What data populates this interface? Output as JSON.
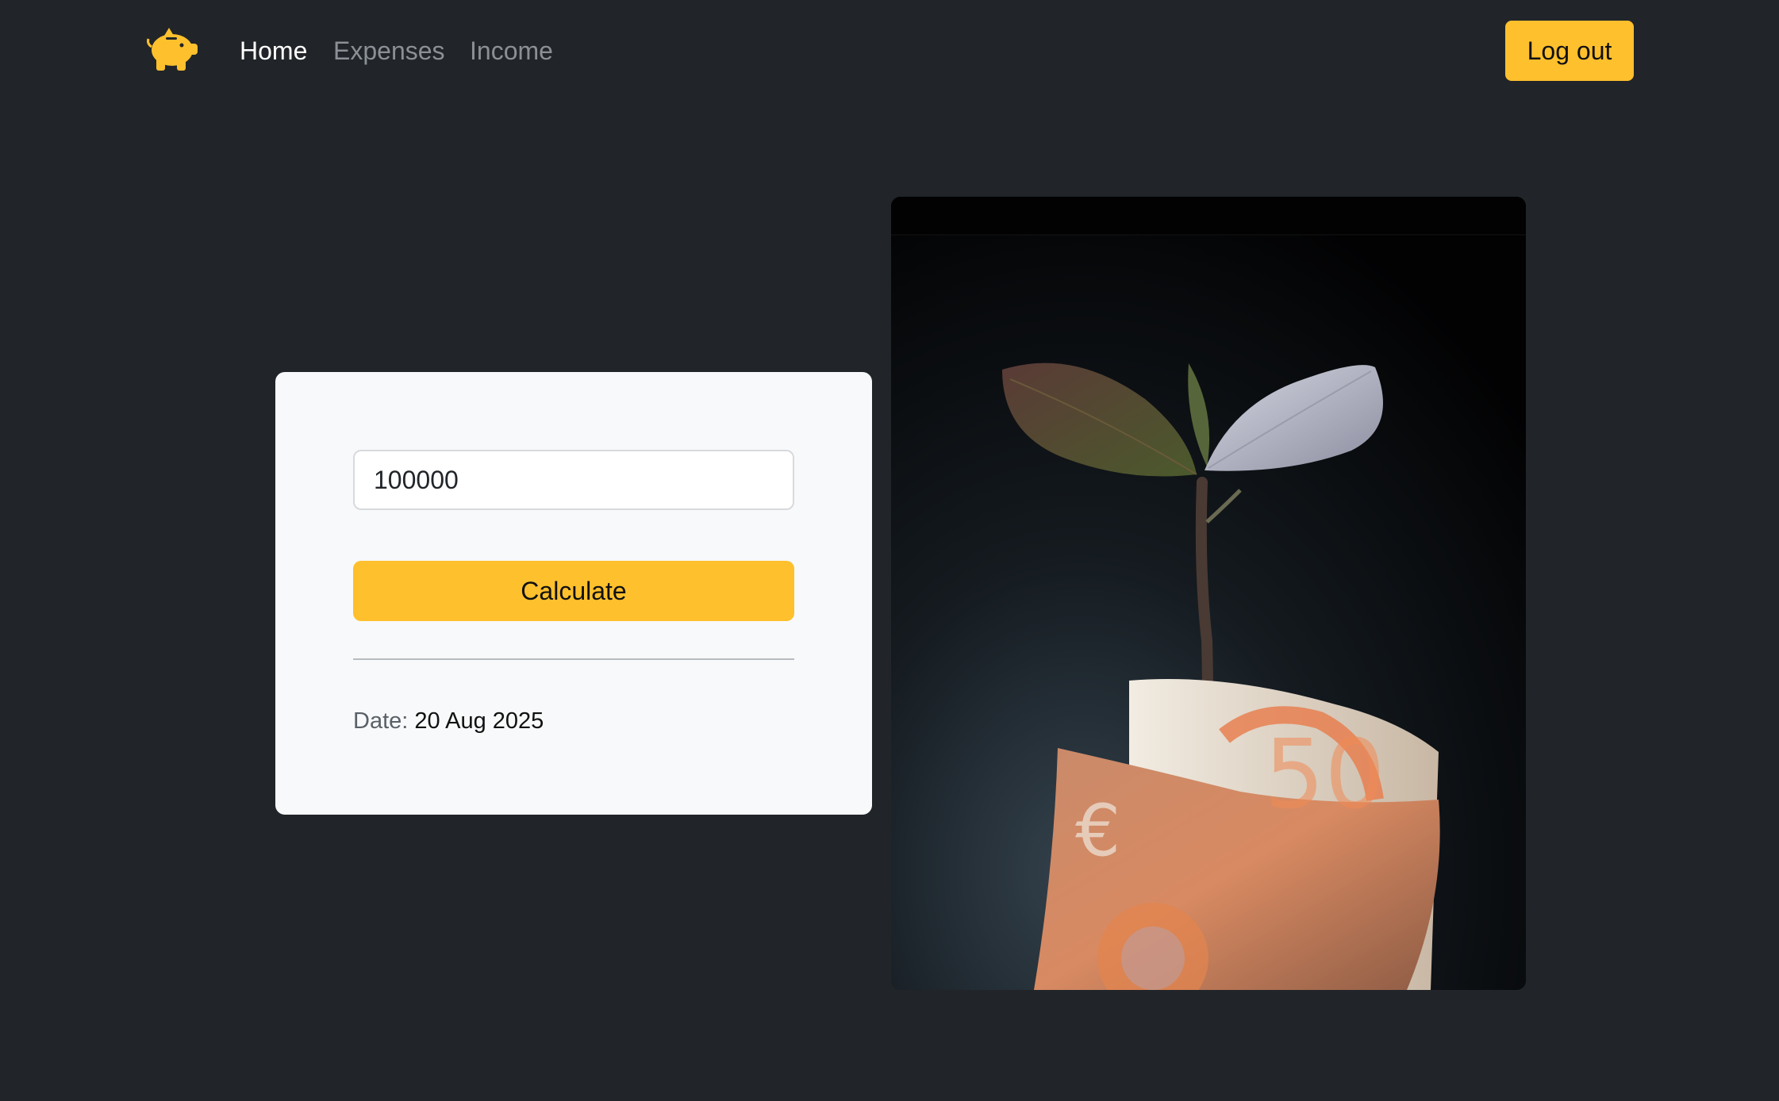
{
  "nav": {
    "logo_icon": "piggy-bank-icon",
    "links": [
      {
        "label": "Home",
        "active": true
      },
      {
        "label": "Expenses",
        "active": false
      },
      {
        "label": "Income",
        "active": false
      }
    ],
    "logout_label": "Log out"
  },
  "calculator": {
    "amount_value": "100000",
    "calculate_label": "Calculate",
    "date_label": "Date:",
    "date_value": "20 Aug 2025"
  },
  "hero": {
    "subject": "plant-sprout-in-banknote-image",
    "banknote_symbol": "€",
    "banknote_number": "50"
  },
  "colors": {
    "background": "#212529",
    "accent": "#ffc02d",
    "card": "#f8f9fa",
    "nav_active": "#ffffff",
    "nav_inactive": "#8c9096"
  }
}
